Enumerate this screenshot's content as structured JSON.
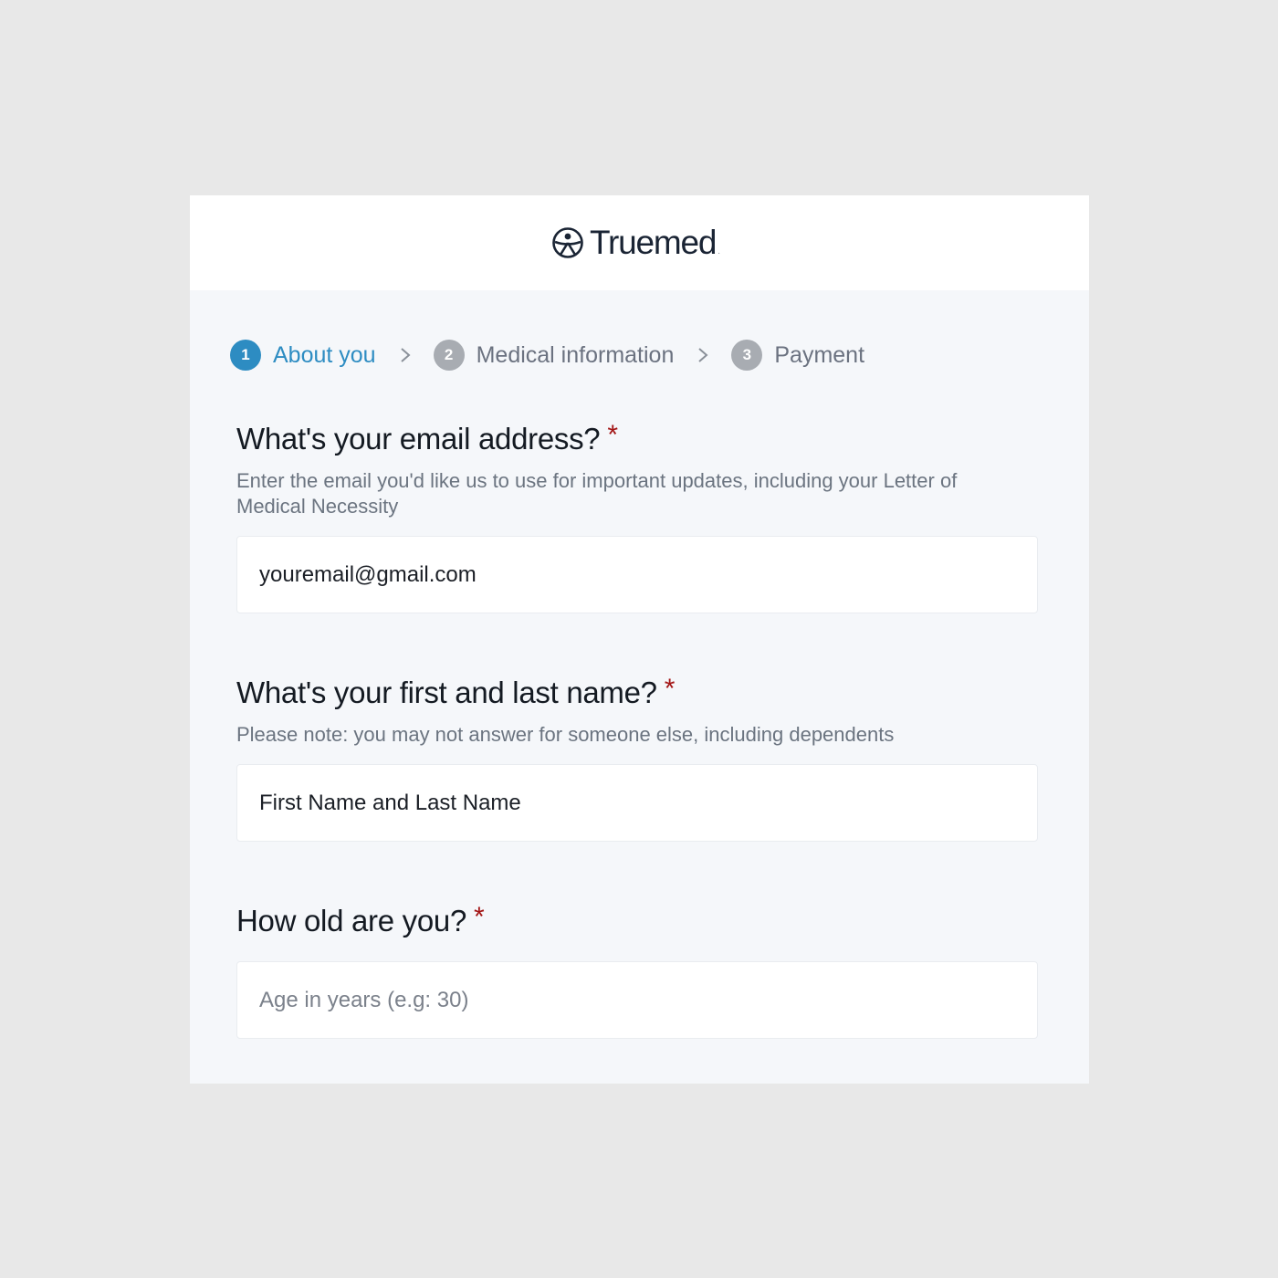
{
  "brand": {
    "name": "Truemed",
    "mark": "."
  },
  "stepper": [
    {
      "number": "1",
      "label": "About you",
      "state": "active"
    },
    {
      "number": "2",
      "label": "Medical information",
      "state": "inactive"
    },
    {
      "number": "3",
      "label": "Payment",
      "state": "inactive"
    }
  ],
  "colors": {
    "accent": "#2d8cc2",
    "required": "#a31515",
    "inactive_step": "#a8acb2"
  },
  "form": {
    "email": {
      "question": "What's your email address?",
      "required_mark": "*",
      "help": "Enter the email you'd like us to use for important updates, including your Letter of Medical Necessity",
      "value": "youremail@gmail.com"
    },
    "name": {
      "question": "What's your first and last name?",
      "required_mark": "*",
      "help": "Please note: you may not answer for someone else, including dependents",
      "value": "First Name and Last Name"
    },
    "age": {
      "question": "How old are you?",
      "required_mark": "*",
      "placeholder": "Age in years (e.g: 30)"
    }
  }
}
